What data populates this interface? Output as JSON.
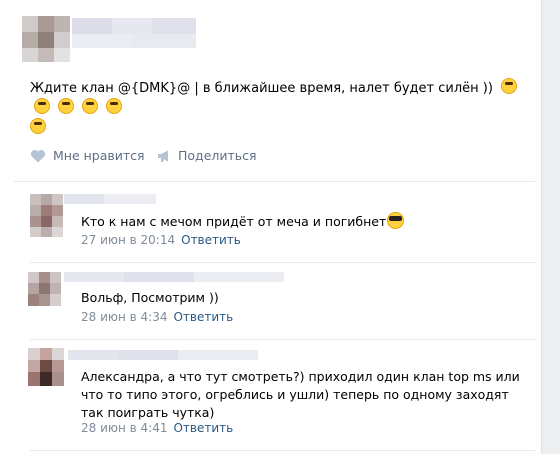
{
  "post": {
    "text": "Ждите клан @{DMK}@ | в ближайшее время, налет будет силён ))",
    "emoji_icons": [
      "grin-emoji-icon",
      "grin-emoji-icon",
      "wink-emoji-icon",
      "wink-emoji-icon",
      "smile-emoji-icon",
      "smile-emoji-icon"
    ]
  },
  "actions": {
    "like_label": "Мне нравится",
    "share_label": "Поделиться"
  },
  "comments": [
    {
      "text": "Кто к нам с мечом придёт от меча и погибнет",
      "date": "27 июн в 20:14",
      "reply_label": "Ответить"
    },
    {
      "text": "Вольф, Посмотрим ))",
      "date": "28 июн в 4:34",
      "reply_label": "Ответить"
    },
    {
      "text": "Александра, а что тут смотреть?) приходил один клан top ms или что то типо этого, огреблись и ушли) теперь по одному заходят так поиграть чутка)",
      "date": "28 июн в 4:41",
      "reply_label": "Ответить"
    }
  ],
  "colors": {
    "link": "#2a5885",
    "meta": "#818c99",
    "action": "#5f6f86",
    "background": "#edeef0"
  }
}
